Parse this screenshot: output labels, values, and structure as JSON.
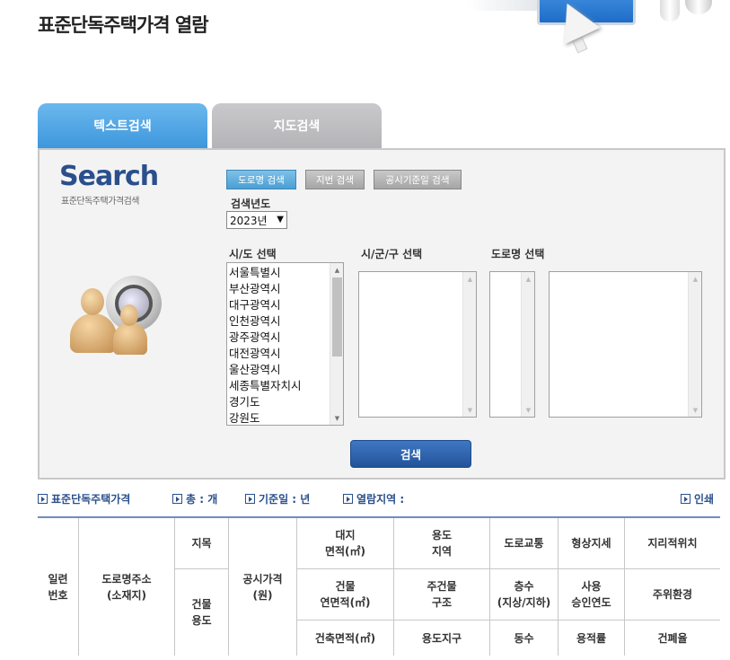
{
  "page_title": "표준단독주택가격 열람",
  "tabs": [
    {
      "label": "텍스트검색",
      "active": true
    },
    {
      "label": "지도검색",
      "active": false
    }
  ],
  "search_panel": {
    "logo_text": "Search",
    "logo_subtitle": "표준단독주택가격검색",
    "modes": [
      "도로명 검색",
      "지번 검색",
      "공시기준일 검색"
    ],
    "active_mode": "도로명 검색",
    "year_label": "검색년도",
    "year_selected": "2023년",
    "sido_label": "시/도 선택",
    "sgg_label": "시/군/구 선택",
    "road_label": "도로명 선택",
    "sido_options": [
      "서울특별시",
      "부산광역시",
      "대구광역시",
      "인천광역시",
      "광주광역시",
      "대전광역시",
      "울산광역시",
      "세종특별자치시",
      "경기도",
      "강원도"
    ],
    "search_button": "검색"
  },
  "summary": {
    "item1": "표준단독주택가격",
    "item2": "총 : 개",
    "item3": "기준일 : 년",
    "item4": "열람지역 :",
    "print": "인쇄"
  },
  "table_headers": {
    "serial": "일련\n번호",
    "address": "도로명주소\n(소재지)",
    "land_category": "지목",
    "building_use": "건물\n용도",
    "price": "공시가격\n(원)",
    "land_area": "대지\n면적(㎡)",
    "zoning": "용도\n지역",
    "road_access": "도로교통",
    "shape": "형상지세",
    "location": "지리적위치",
    "floor_area": "건물\n연면적(㎡)",
    "structure": "주건물\n구조",
    "floors": "층수\n(지상/지하)",
    "approval_year": "사용\n승인연도",
    "surroundings": "주위환경",
    "building_area": "건축면적(㎡)",
    "district": "용도지구",
    "building_count": "동수",
    "far": "용적률",
    "bcr": "건폐율"
  }
}
